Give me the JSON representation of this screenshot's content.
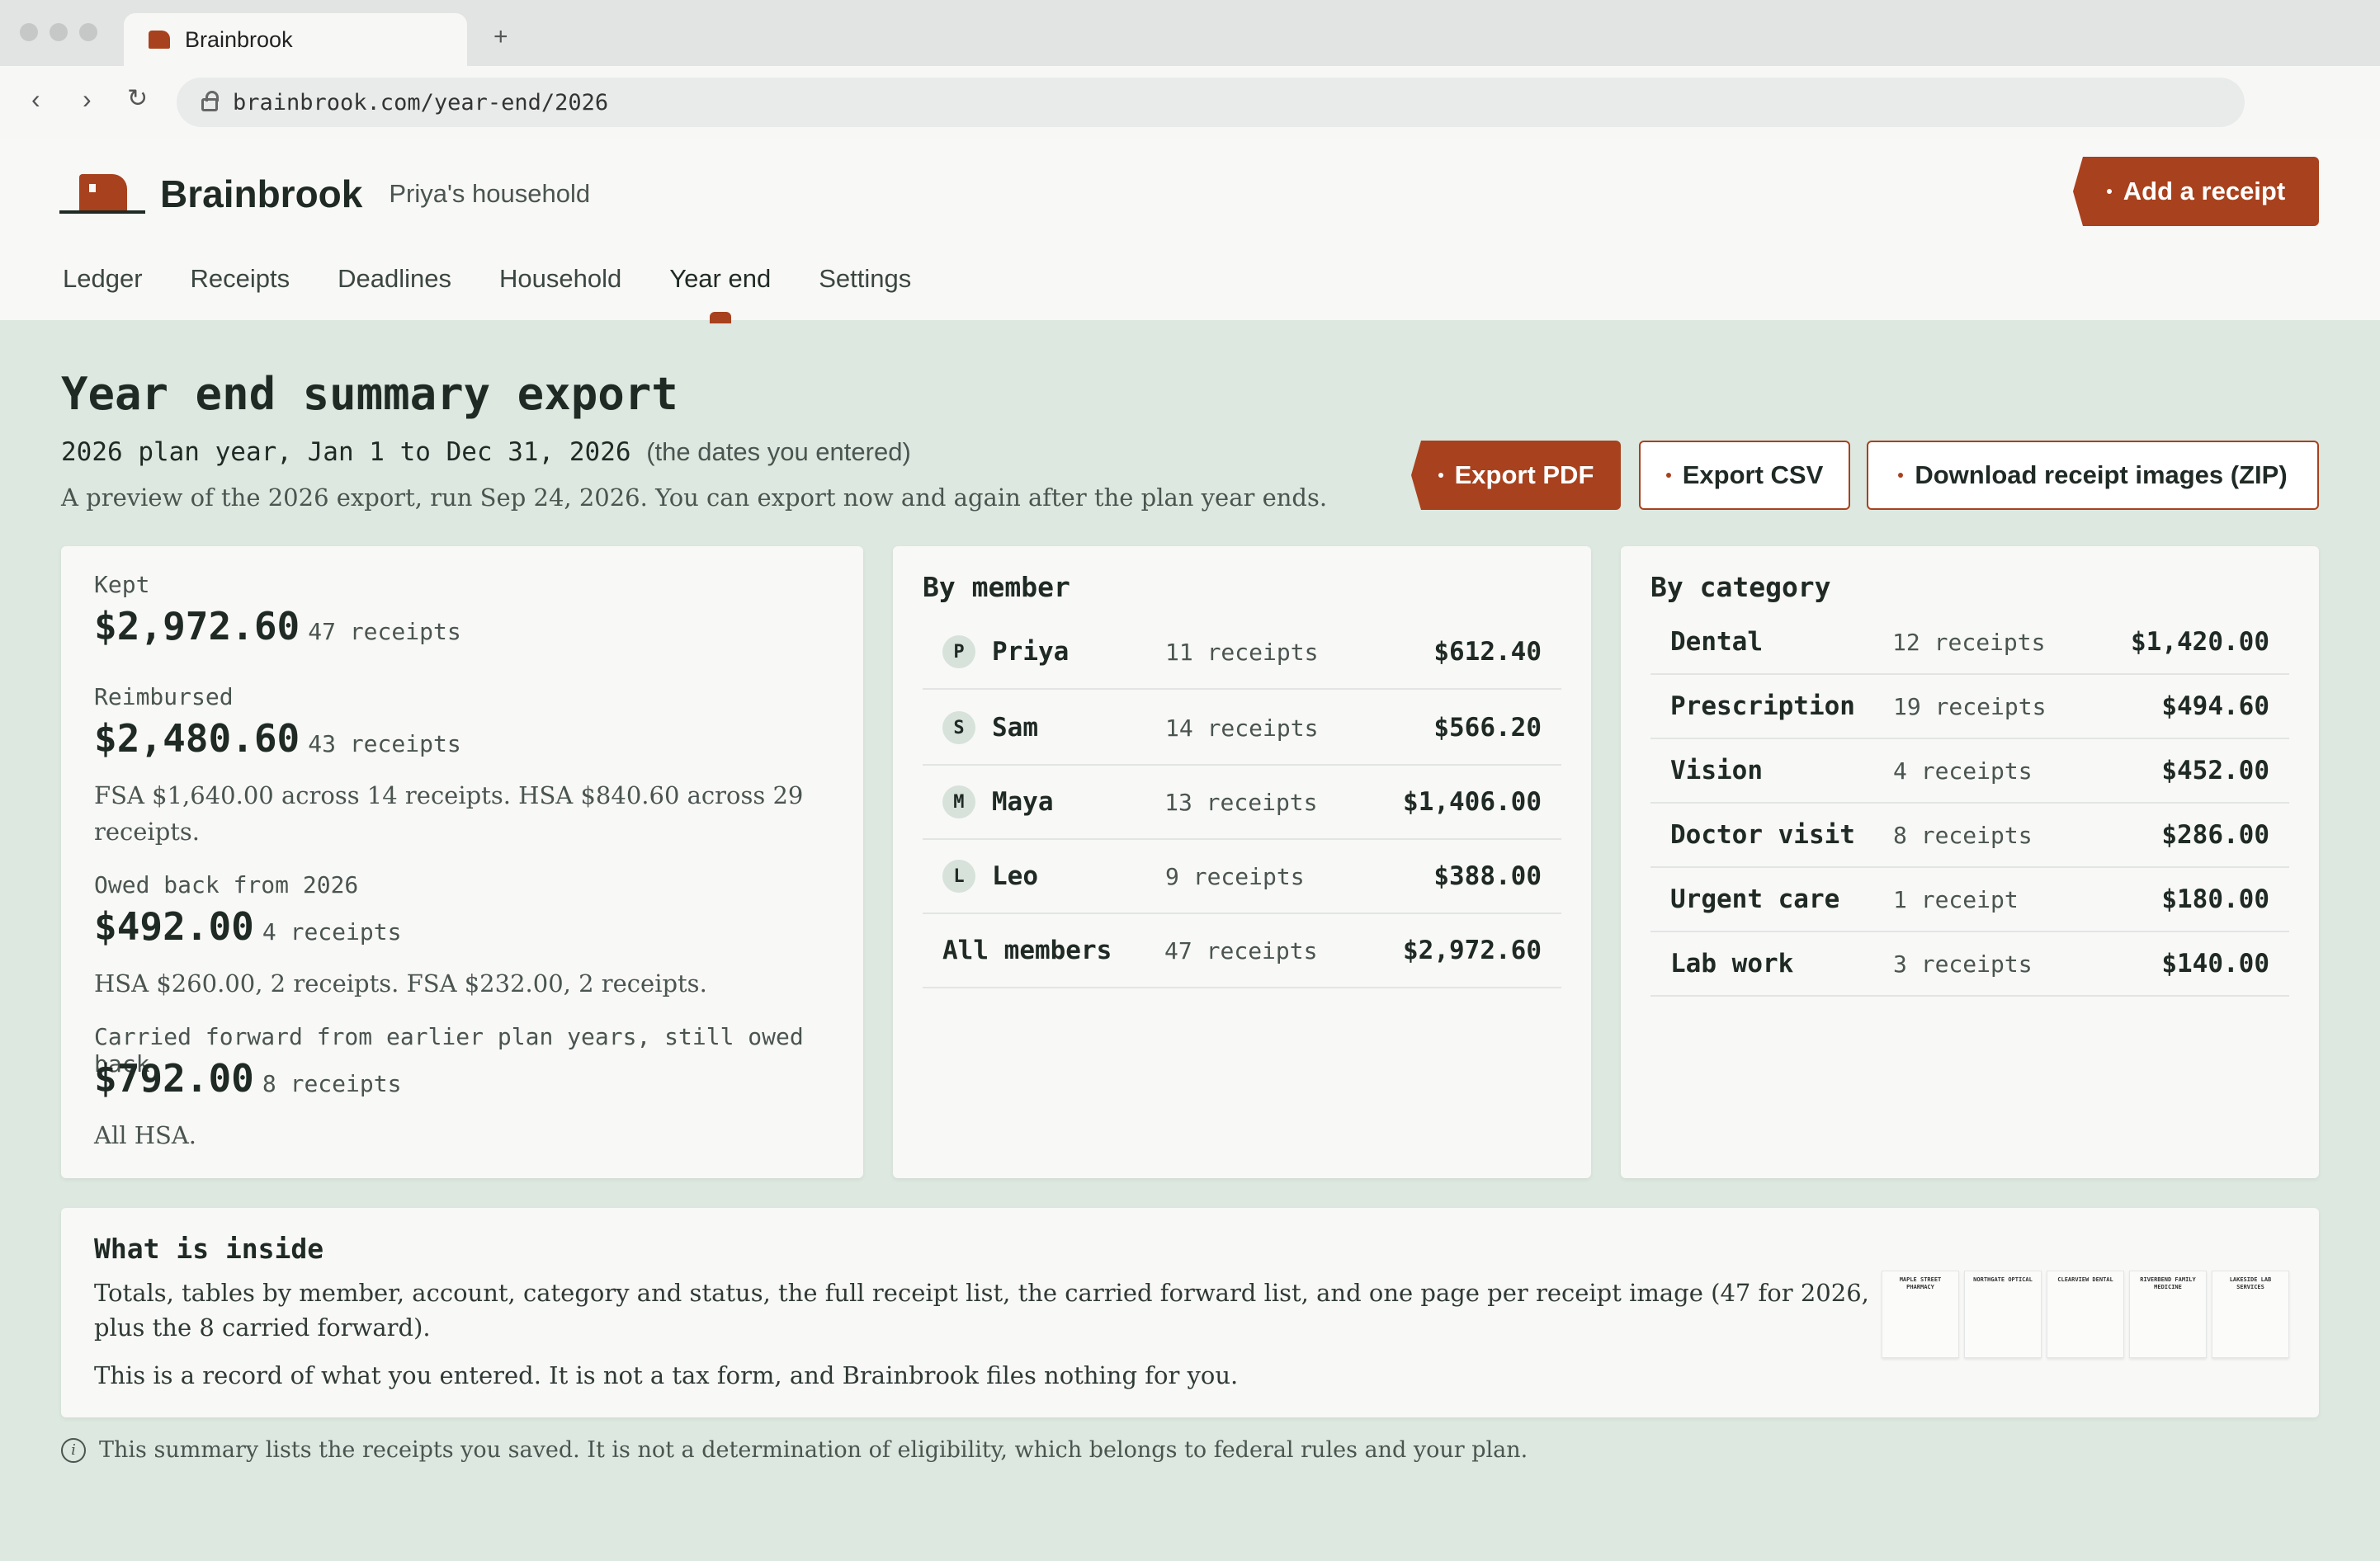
{
  "browser": {
    "tab_title": "Brainbrook",
    "new_tab": "+",
    "back": "‹",
    "forward": "›",
    "reload": "↻",
    "url": "brainbrook.com/year-end/2026"
  },
  "header": {
    "brand": "Brainbrook",
    "household": "Priya's household",
    "add_receipt": "Add a receipt",
    "nav": [
      "Ledger",
      "Receipts",
      "Deadlines",
      "Household",
      "Year end",
      "Settings"
    ],
    "active_nav": "Year end"
  },
  "page": {
    "title": "Year end summary export",
    "subtitle_dates": "2026 plan year, Jan 1 to Dec 31, 2026",
    "subtitle_note": "(the dates you entered)",
    "description": "A preview of the 2026 export, run Sep 24, 2026. You can export now and again after the plan year ends.",
    "export_pdf": "Export PDF",
    "export_csv": "Export CSV",
    "download_zip": "Download receipt images (ZIP)"
  },
  "totals": {
    "kept_label": "Kept",
    "kept_value": "$2,972.60",
    "kept_count": "47 receipts",
    "reimbursed_label": "Reimbursed",
    "reimbursed_value": "$2,480.60",
    "reimbursed_count": "43 receipts",
    "reimbursed_note": "FSA $1,640.00 across 14 receipts. HSA $840.60 across 29 receipts.",
    "owed_label": "Owed back from 2026",
    "owed_value": "$492.00",
    "owed_count": "4 receipts",
    "owed_note": "HSA $260.00, 2 receipts. FSA $232.00, 2 receipts.",
    "carried_label": "Carried forward from earlier plan years, still owed back",
    "carried_value": "$792.00",
    "carried_count": "8 receipts",
    "carried_note": "All HSA."
  },
  "by_member": {
    "title": "By member",
    "rows": [
      {
        "initial": "P",
        "name": "Priya",
        "count": "11 receipts",
        "amount": "$612.40"
      },
      {
        "initial": "S",
        "name": "Sam",
        "count": "14 receipts",
        "amount": "$566.20"
      },
      {
        "initial": "M",
        "name": "Maya",
        "count": "13 receipts",
        "amount": "$1,406.00"
      },
      {
        "initial": "L",
        "name": "Leo",
        "count": "9 receipts",
        "amount": "$388.00"
      }
    ],
    "total": {
      "name": "All members",
      "count": "47 receipts",
      "amount": "$2,972.60"
    }
  },
  "by_category": {
    "title": "By category",
    "rows": [
      {
        "name": "Dental",
        "count": "12 receipts",
        "amount": "$1,420.00"
      },
      {
        "name": "Prescription",
        "count": "19 receipts",
        "amount": "$494.60"
      },
      {
        "name": "Vision",
        "count": "4 receipts",
        "amount": "$452.00"
      },
      {
        "name": "Doctor visit",
        "count": "8 receipts",
        "amount": "$286.00"
      },
      {
        "name": "Urgent care",
        "count": "1 receipt",
        "amount": "$180.00"
      },
      {
        "name": "Lab work",
        "count": "3 receipts",
        "amount": "$140.00"
      }
    ]
  },
  "inside": {
    "title": "What is inside",
    "p1": "Totals, tables by member, account, category and status, the full receipt list, the carried forward list, and one page per receipt image (47 for 2026, plus the 8 carried forward).",
    "p2": "This is a record of what you entered. It is not a tax form, and Brainbrook files nothing for you.",
    "thumbnails": [
      "MAPLE STREET PHARMACY",
      "NORTHGATE OPTICAL",
      "CLEARVIEW DENTAL",
      "RIVERBEND FAMILY MEDICINE",
      "LAKESIDE LAB SERVICES"
    ]
  },
  "footer_note": "This summary lists the receipts you saved. It is not a determination of eligibility, which belongs to federal rules and your plan.",
  "colors": {
    "accent": "#a8411d",
    "background": "#dce8e0",
    "card": "#f8f8f7"
  },
  "icons": {
    "info": "info-icon",
    "lock": "lock-icon",
    "logo": "house-logo-icon"
  }
}
